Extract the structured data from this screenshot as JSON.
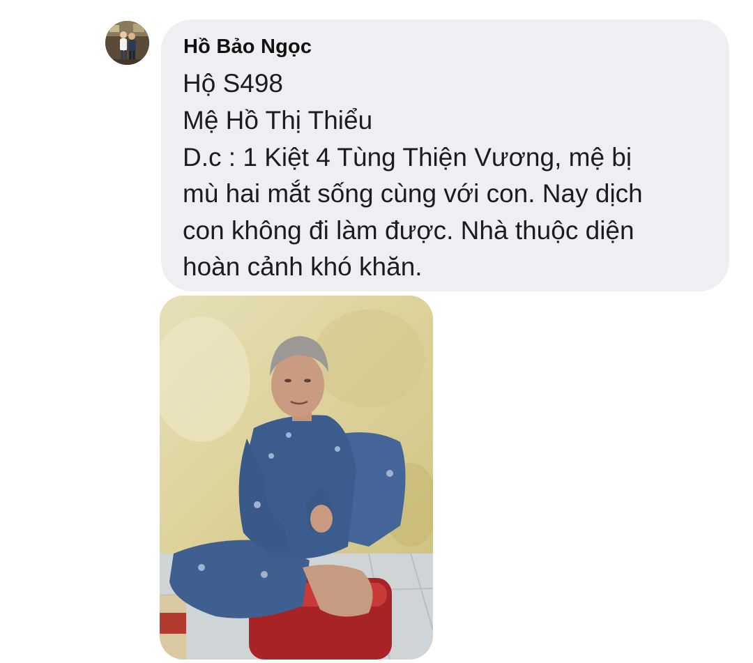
{
  "comment": {
    "author_name": "Hồ Bảo Ngọc",
    "avatar_icon": "user-avatar-photo",
    "message_lines": [
      "Hộ S498",
      "Mệ Hồ Thị Thiểu",
      "D.c : 1 Kiệt 4 Tùng Thiện Vương, mệ bị",
      "mù hai mắt sống cùng với con. Nay dịch",
      "con không đi làm được. Nhà thuộc diện",
      "hoàn cảnh khó khăn."
    ],
    "attachment_icon": "elderly-woman-photo"
  },
  "colors": {
    "bubble_background": "#eeeff3",
    "text": "#1c1c1e",
    "page_background": "#ffffff"
  }
}
